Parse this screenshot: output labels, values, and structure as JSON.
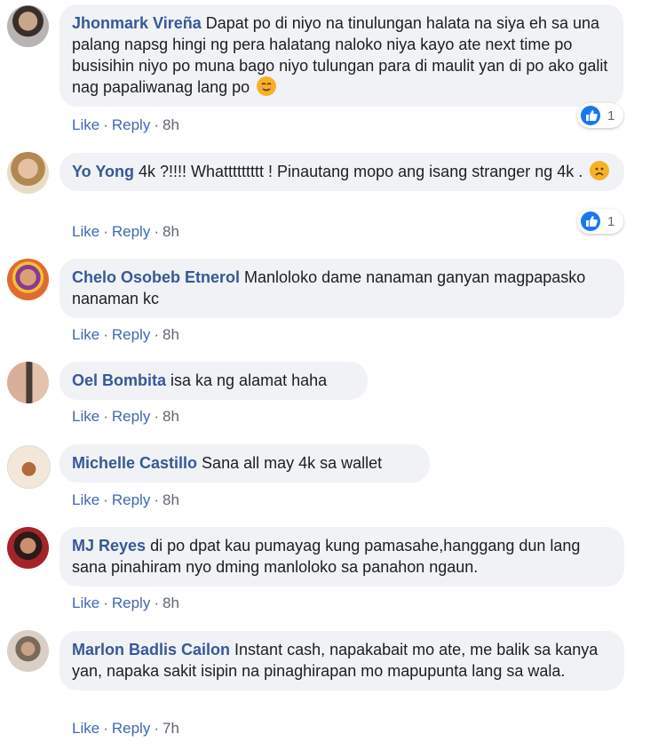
{
  "comments": [
    {
      "name": "Jhonmark Vireña",
      "text": "Dapat po di niyo na tinulungan halata na siya eh sa una palang napsg hingi ng pera halatang naloko niya kayo ate next time po busisihin niyo po muna bago niyo tulungan para di maulit yan di po ako galit nag papaliwanag lang po",
      "like": "Like",
      "reply": "Reply",
      "time": "8h",
      "reactions": "1",
      "emoji": "smile"
    },
    {
      "name": "Yo Yong",
      "text": "4k ?!!!! Whattttttttt ! Pinautang mopo ang isang stranger ng 4k .",
      "like": "Like",
      "reply": "Reply",
      "time": "8h",
      "reactions": "1",
      "emoji": "sad"
    },
    {
      "name": "Chelo Osobeb Etnerol",
      "text": "Manloloko dame nanaman ganyan magpapasko nanaman kc",
      "like": "Like",
      "reply": "Reply",
      "time": "8h"
    },
    {
      "name": "Oel Bombita",
      "text": "isa ka ng alamat haha",
      "like": "Like",
      "reply": "Reply",
      "time": "8h"
    },
    {
      "name": "Michelle Castillo",
      "text": "Sana all may 4k sa wallet",
      "like": "Like",
      "reply": "Reply",
      "time": "8h"
    },
    {
      "name": "MJ Reyes",
      "text": "di po dpat kau pumayag kung pamasahe,hanggang dun lang sana pinahiram nyo dming manloloko sa panahon ngaun.",
      "like": "Like",
      "reply": "Reply",
      "time": "8h"
    },
    {
      "name": "Marlon Badlis Cailon",
      "text": "Instant cash, napakabait mo ate, me balik sa kanya yan, napaka sakit isipin na pinaghirapan mo mapupunta lang sa wala.",
      "like": "Like",
      "reply": "Reply",
      "time": "7h"
    }
  ],
  "colors": {
    "name": "#385898",
    "link": "#4267b2",
    "bubble": "#f0f2f5",
    "like_badge": "#1877f2"
  },
  "icons": {
    "like_reaction": "thumbs-up-icon",
    "emoji_smile": "smiling-face-icon",
    "emoji_sad": "sad-face-icon"
  }
}
